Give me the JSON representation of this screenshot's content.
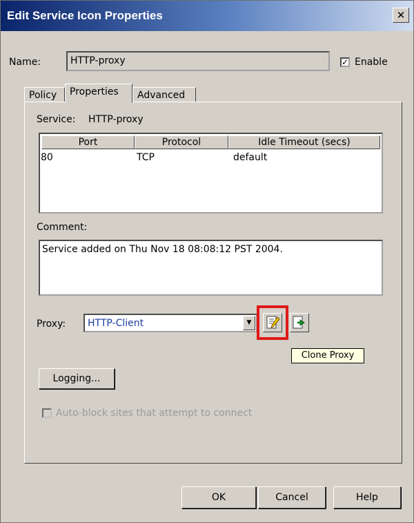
{
  "window": {
    "title": "Edit Service Icon Properties",
    "close_glyph": "✕"
  },
  "name_row": {
    "label": "Name:",
    "value": "HTTP-proxy",
    "enable_label": "Enable",
    "enable_checked": true,
    "check_glyph": "✓"
  },
  "tabs": [
    {
      "label": "Policy",
      "active": false
    },
    {
      "label": "Properties",
      "active": true
    },
    {
      "label": "Advanced",
      "active": false
    }
  ],
  "service": {
    "label": "Service:",
    "value": "HTTP-proxy"
  },
  "table": {
    "columns": [
      "Port",
      "Protocol",
      "Idle Timeout (secs)"
    ],
    "rows": [
      [
        "80",
        "TCP",
        "default"
      ]
    ]
  },
  "comment": {
    "label": "Comment:",
    "value": "Service added on Thu Nov 18 08:08:12 PST 2004."
  },
  "proxy": {
    "label": "Proxy:",
    "selected": "HTTP-Client",
    "dropdown_glyph": "▼",
    "edit_icon": "edit-proxy-icon",
    "clone_icon": "clone-proxy-icon"
  },
  "tooltip": {
    "text": "Clone Proxy"
  },
  "highlight_color": "#e01818",
  "logging_button": "Logging...",
  "autoblock": {
    "label": "Auto-block sites that attempt to connect",
    "checked": false,
    "enabled": false
  },
  "buttons": {
    "ok": "OK",
    "cancel": "Cancel",
    "help": "Help"
  }
}
